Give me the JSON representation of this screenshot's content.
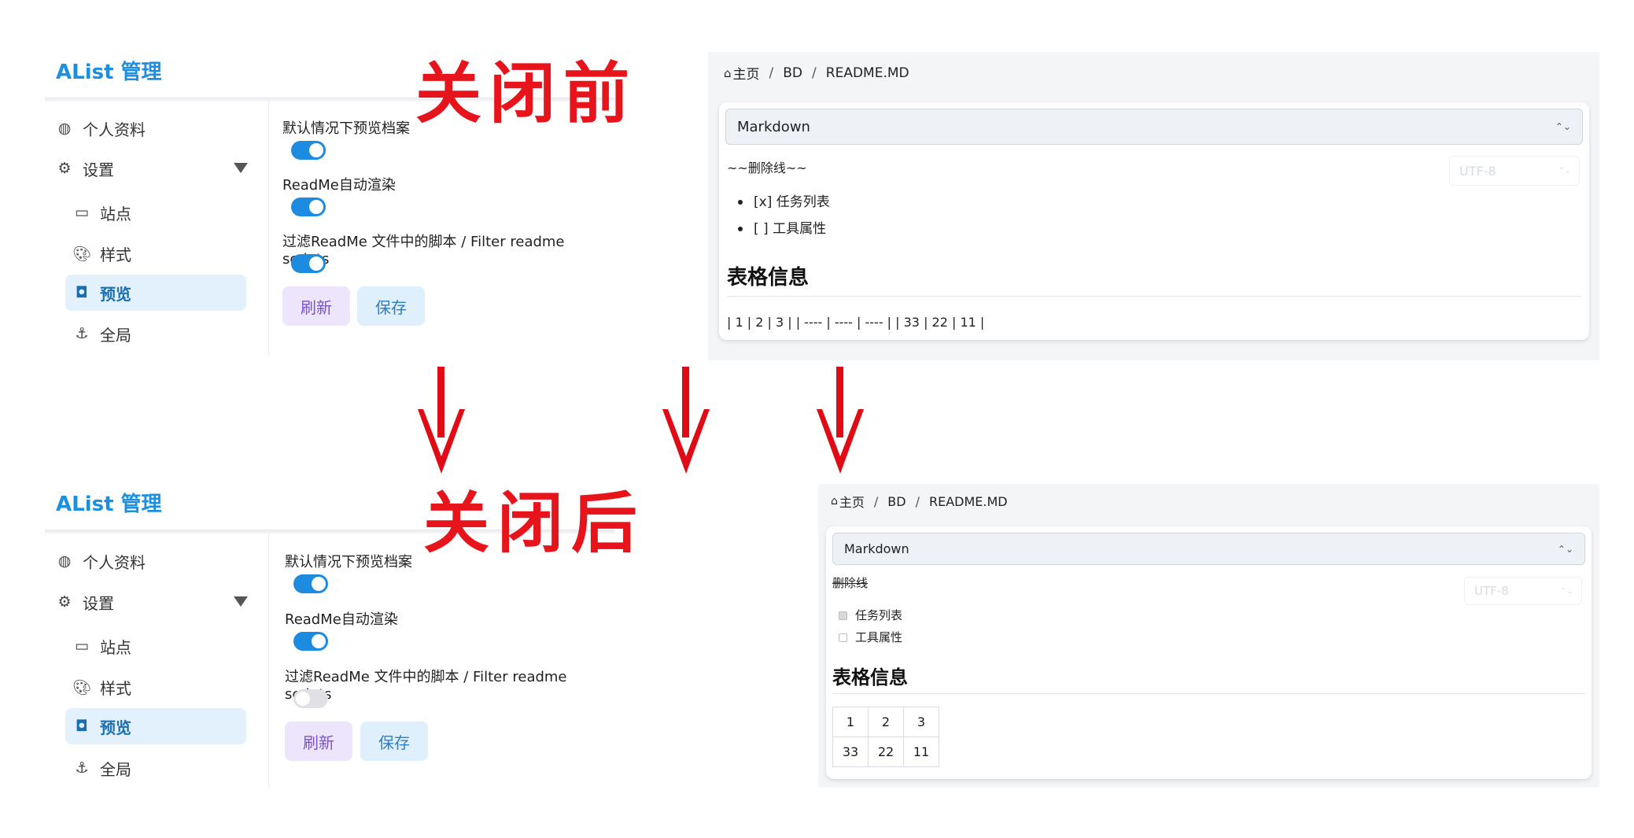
{
  "annotations": {
    "before": "关闭前",
    "after": "关闭后"
  },
  "admin_before": {
    "brand": "AList 管理",
    "menu": {
      "profile": "个人资料",
      "settings": "设置",
      "site": "站点",
      "style": "样式",
      "preview": "预览",
      "global": "全局"
    },
    "options": [
      {
        "label": "默认情况下预览档案",
        "enabled": true
      },
      {
        "label": "ReadMe自动渲染",
        "enabled": true
      },
      {
        "label": "过滤ReadMe 文件中的脚本 / Filter readme scripts",
        "enabled": true
      }
    ],
    "buttons": {
      "refresh": "刷新",
      "save": "保存"
    }
  },
  "admin_after": {
    "brand": "AList 管理",
    "menu": {
      "profile": "个人资料",
      "settings": "设置",
      "site": "站点",
      "style": "样式",
      "preview": "预览",
      "global": "全局"
    },
    "options": [
      {
        "label": "默认情况下预览档案",
        "enabled": true
      },
      {
        "label": "ReadMe自动渲染",
        "enabled": true
      },
      {
        "label": "过滤ReadMe 文件中的脚本 / Filter readme scripts",
        "enabled": false
      }
    ],
    "buttons": {
      "refresh": "刷新",
      "save": "保存"
    }
  },
  "preview_before": {
    "breadcrumb": [
      "主页",
      "BD",
      "README.MD"
    ],
    "viewer": "Markdown",
    "encoding": "UTF-8",
    "strike_raw": "~~删除线~~",
    "list": [
      "[x] 任务列表",
      "[ ] 工具属性"
    ],
    "heading": "表格信息",
    "table_raw": "| 1 | 2 | 3 | | ---- | ---- | ---- | | 33 | 22 | 11 |"
  },
  "preview_after": {
    "breadcrumb": [
      "主页",
      "BD",
      "README.MD"
    ],
    "viewer": "Markdown",
    "encoding": "UTF-8",
    "strike": "删除线",
    "tasks": [
      {
        "label": "任务列表",
        "checked": true
      },
      {
        "label": "工具属性",
        "checked": false
      }
    ],
    "heading": "表格信息",
    "table": [
      [
        "1",
        "2",
        "3"
      ],
      [
        "33",
        "22",
        "11"
      ]
    ]
  },
  "colors": {
    "accent": "#1d8be0",
    "annotation_red": "#e8141c",
    "arrow_red": "#e00b14"
  }
}
